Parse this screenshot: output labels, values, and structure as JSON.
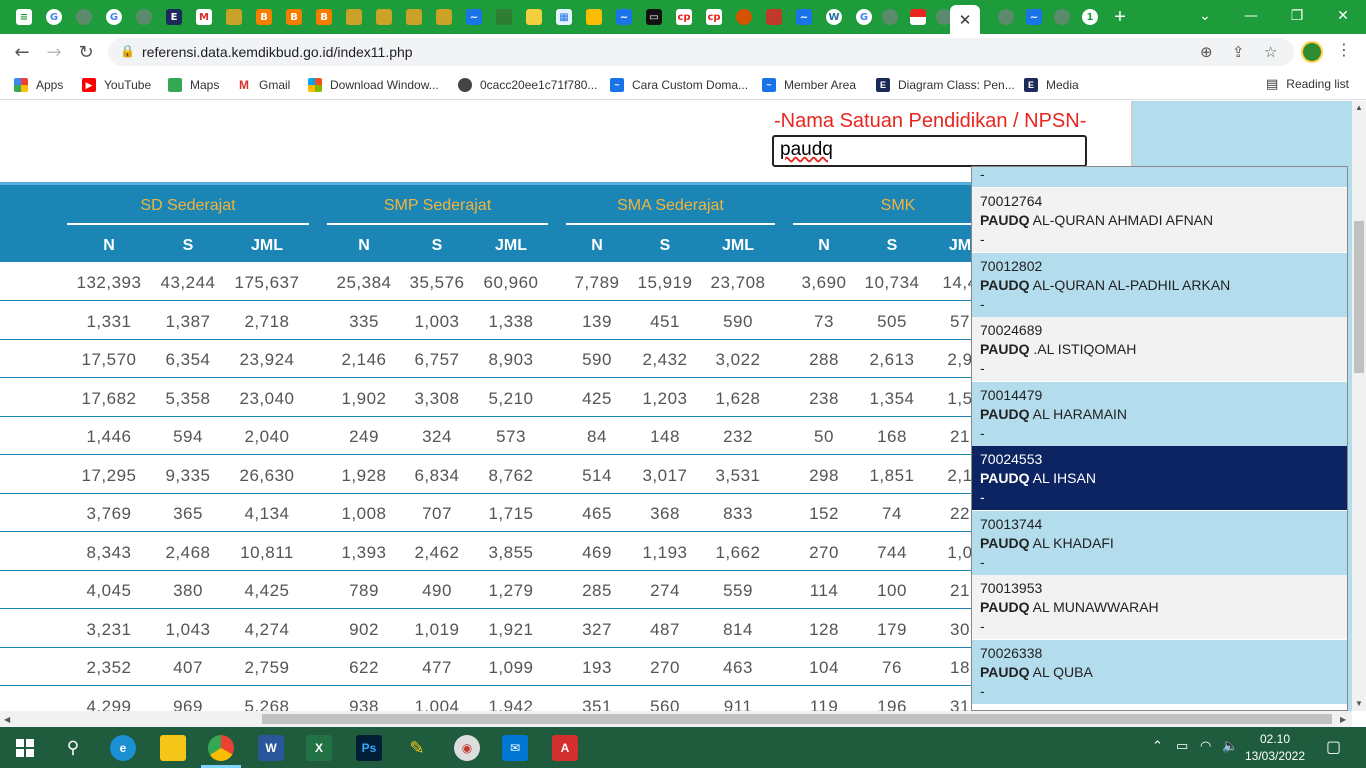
{
  "browser": {
    "active_tab_close": "✕",
    "url": "referensi.data.kemdikbud.go.id/index11.php",
    "bookmarks": [
      {
        "label": "Apps",
        "color": "#e94235"
      },
      {
        "label": "YouTube",
        "color": "#ff0000"
      },
      {
        "label": "Maps",
        "color": "#34a853"
      },
      {
        "label": "Gmail",
        "color": "#d93025"
      },
      {
        "label": "Download Window...",
        "color": "#f25022"
      },
      {
        "label": "0cacc20ee1c71f780...",
        "color": "#444444"
      },
      {
        "label": "Cara Custom Doma...",
        "color": "#1a73e8"
      },
      {
        "label": "Member Area",
        "color": "#1a73e8"
      },
      {
        "label": "Diagram Class: Pen...",
        "color": "#1c2a5a"
      },
      {
        "label": "Media",
        "color": "#1c2a5a"
      }
    ],
    "reading_list": "Reading list"
  },
  "search": {
    "label": "-Nama Satuan Pendidikan / NPSN-",
    "value": "paudq"
  },
  "table": {
    "groups": [
      "SD Sederajat",
      "SMP Sederajat",
      "SMA Sederajat",
      "SMK"
    ],
    "subheaders": [
      "N",
      "S",
      "JML",
      "N",
      "S",
      "JML",
      "N",
      "S",
      "JML",
      "N",
      "S",
      "JM"
    ],
    "rows": [
      [
        "132,393",
        "43,244",
        "175,637",
        "25,384",
        "35,576",
        "60,960",
        "7,789",
        "15,919",
        "23,708",
        "3,690",
        "10,734",
        "14,4"
      ],
      [
        "1,331",
        "1,387",
        "2,718",
        "335",
        "1,003",
        "1,338",
        "139",
        "451",
        "590",
        "73",
        "505",
        "57"
      ],
      [
        "17,570",
        "6,354",
        "23,924",
        "2,146",
        "6,757",
        "8,903",
        "590",
        "2,432",
        "3,022",
        "288",
        "2,613",
        "2,9"
      ],
      [
        "17,682",
        "5,358",
        "23,040",
        "1,902",
        "3,308",
        "5,210",
        "425",
        "1,203",
        "1,628",
        "238",
        "1,354",
        "1,5"
      ],
      [
        "1,446",
        "594",
        "2,040",
        "249",
        "324",
        "573",
        "84",
        "148",
        "232",
        "50",
        "168",
        "21"
      ],
      [
        "17,295",
        "9,335",
        "26,630",
        "1,928",
        "6,834",
        "8,762",
        "514",
        "3,017",
        "3,531",
        "298",
        "1,851",
        "2,1"
      ],
      [
        "3,769",
        "365",
        "4,134",
        "1,008",
        "707",
        "1,715",
        "465",
        "368",
        "833",
        "152",
        "74",
        "22"
      ],
      [
        "8,343",
        "2,468",
        "10,811",
        "1,393",
        "2,462",
        "3,855",
        "469",
        "1,193",
        "1,662",
        "270",
        "744",
        "1,0"
      ],
      [
        "4,045",
        "380",
        "4,425",
        "789",
        "490",
        "1,279",
        "285",
        "274",
        "559",
        "114",
        "100",
        "21"
      ],
      [
        "3,231",
        "1,043",
        "4,274",
        "902",
        "1,019",
        "1,921",
        "327",
        "487",
        "814",
        "128",
        "179",
        "30"
      ],
      [
        "2,352",
        "407",
        "2,759",
        "622",
        "477",
        "1,099",
        "193",
        "270",
        "463",
        "104",
        "76",
        "18"
      ],
      [
        "4,299",
        "969",
        "5,268",
        "938",
        "1,004",
        "1,942",
        "351",
        "560",
        "911",
        "119",
        "196",
        "31"
      ]
    ]
  },
  "dropdown": {
    "top_partial": "-",
    "items": [
      {
        "npsn": "70012764",
        "match": "PAUDQ",
        "rest": " AL-QURAN AHMADI AFNAN",
        "extra": "-"
      },
      {
        "npsn": "70012802",
        "match": "PAUDQ",
        "rest": " AL-QURAN AL-PADHIL ARKAN",
        "extra": "-"
      },
      {
        "npsn": "70024689",
        "match": "PAUDQ",
        "rest": " .AL ISTIQOMAH",
        "extra": "-"
      },
      {
        "npsn": "70014479",
        "match": "PAUDQ",
        "rest": " AL HARAMAIN",
        "extra": "-"
      },
      {
        "npsn": "70024553",
        "match": "PAUDQ",
        "rest": " AL IHSAN",
        "extra": "-"
      },
      {
        "npsn": "70013744",
        "match": "PAUDQ",
        "rest": " AL KHADAFI",
        "extra": "-"
      },
      {
        "npsn": "70013953",
        "match": "PAUDQ",
        "rest": " AL MUNAWWARAH",
        "extra": "-"
      },
      {
        "npsn": "70026338",
        "match": "PAUDQ",
        "rest": " AL QUBA",
        "extra": "-"
      }
    ],
    "selected_index": 4
  },
  "taskbar": {
    "time": "02.10",
    "date": "13/03/2022"
  }
}
